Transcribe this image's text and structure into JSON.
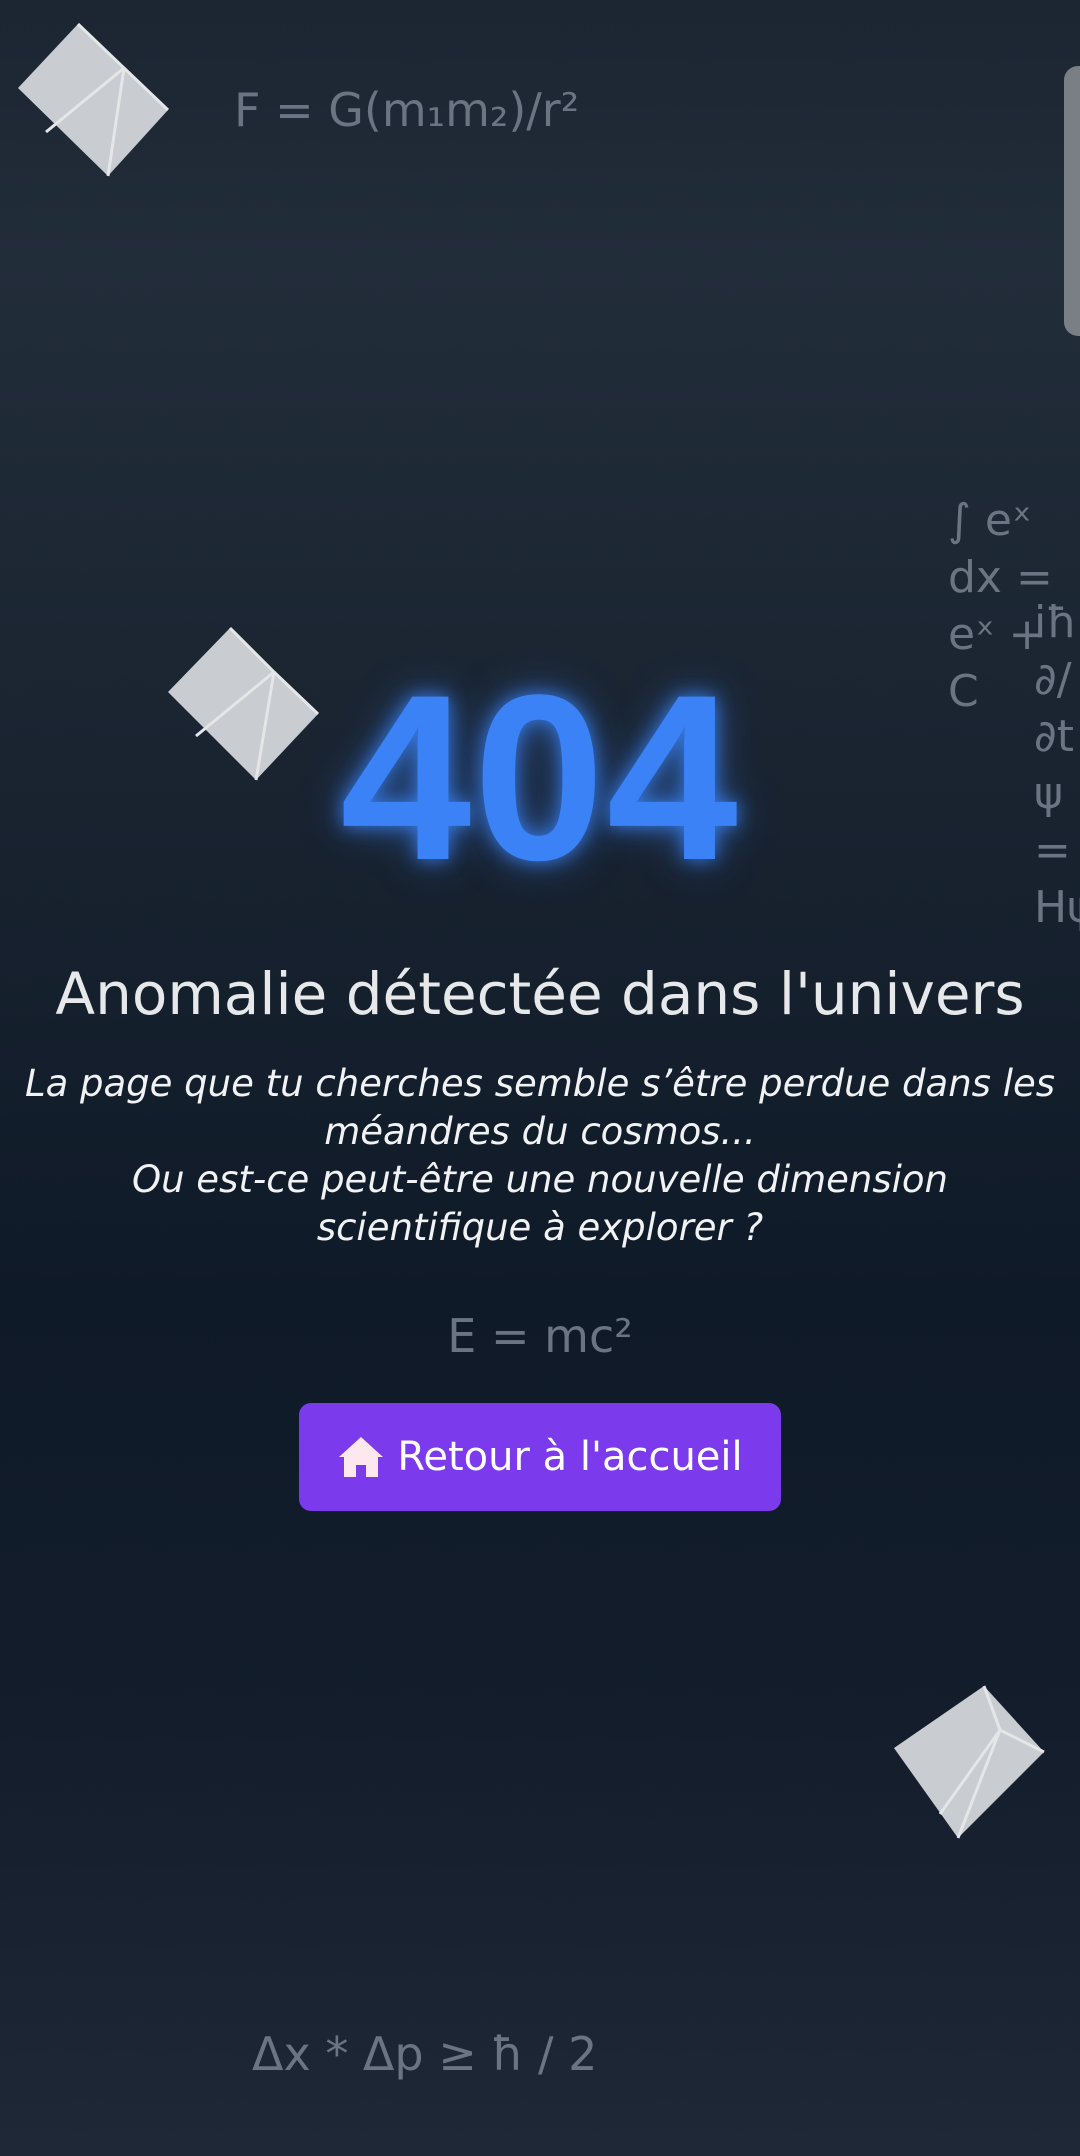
{
  "equations": {
    "gravity": "F = G(m₁m₂)/r²",
    "integral": "∫ eˣ dx = eˣ + C",
    "schrodinger": "iħ ∂/∂t ψ = Hψ",
    "energy": "E = mc²",
    "uncertainty": "Δx * Δp ≥ ħ / 2"
  },
  "error": {
    "code": "404",
    "title": "Anomalie détectée dans l'univers",
    "message_line1": "La page que tu cherches semble s’être perdue dans les méandres du cosmos...",
    "message_line2": "Ou est-ce peut-être une nouvelle dimension scientifique à explorer ?"
  },
  "home_button": {
    "label": "Retour à l'accueil",
    "icon": "home-icon"
  },
  "colors": {
    "accent_code": "#3b82f6",
    "button": "#7c3aed",
    "equation_text": "#6b7483",
    "cube_face": "#c9ccd0"
  }
}
